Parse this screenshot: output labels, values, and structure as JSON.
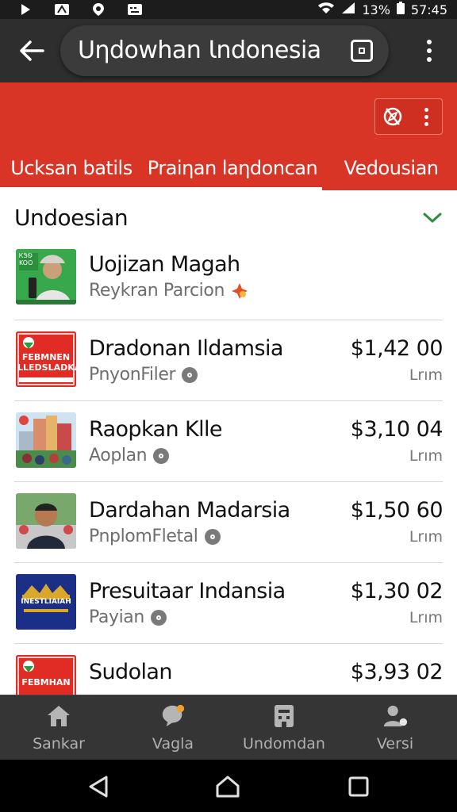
{
  "status_bar": {
    "battery_text": "13%",
    "time": "57:45",
    "icons": [
      "play-icon",
      "alert-icon",
      "location-icon",
      "keyboard-icon",
      "wifi-icon",
      "signal-icon",
      "battery-icon"
    ]
  },
  "app_bar": {
    "title": "Uηdowhan Ɩndonesia",
    "back_icon": "arrow-left-icon",
    "pill_icon": "square-icon",
    "more_icon": "more-vertical-icon"
  },
  "header": {
    "accent_color": "#d93526",
    "actions": [
      "compass-icon",
      "more-vertical-icon"
    ],
    "tabs": [
      {
        "label": "Ucksan batils",
        "active": true
      },
      {
        "label": "Praiηan laηdoncan",
        "active": true
      },
      {
        "label": "Vedousian",
        "active": false
      }
    ]
  },
  "section": {
    "title": "Undoesian",
    "chevron_icon": "chevron-down-icon",
    "chevron_color": "#2e8b3a"
  },
  "items": [
    {
      "title": "Uojizan Magah",
      "subtitle": "Reykran Parcion",
      "price": "",
      "unit": "",
      "thumb_icon": "profile-image"
    },
    {
      "title": "Dradonan Ildamsia",
      "subtitle": "PnyonFiler",
      "price": "$1,42 00",
      "unit": "Lrım",
      "thumb_icon": "red-logo-image"
    },
    {
      "title": "Raopkan Klle",
      "subtitle": "Aoplan",
      "price": "$3,10 04",
      "unit": "Lrım",
      "thumb_icon": "building-image"
    },
    {
      "title": "Dardahan Madarsia",
      "subtitle": "PnplomFletal",
      "price": "$1,50 60",
      "unit": "Lrım",
      "thumb_icon": "person-image"
    },
    {
      "title": "Presuitaar Indansia",
      "subtitle": "Payian",
      "price": "$1,30 02",
      "unit": "Lrım",
      "thumb_icon": "banner-image"
    },
    {
      "title": "Sudolan",
      "subtitle": "",
      "price": "$3,93 02",
      "unit": "",
      "thumb_icon": "red-logo-image"
    }
  ],
  "thumb_texts": {
    "t1_top": "ᏦᏕᏫ",
    "t1_mid": "KOO",
    "t2_top": "FEBMNEN",
    "t2_bot": "LLEDSLADKA",
    "t5": "INESTLIAIAH",
    "t6_top": "FEBMHAN"
  },
  "bottom_nav": [
    {
      "label": "Sankar",
      "icon": "home-icon"
    },
    {
      "label": "Vagla",
      "icon": "chat-bubble-icon"
    },
    {
      "label": "Undomdan",
      "icon": "building-icon"
    },
    {
      "label": "Versi",
      "icon": "person-icon"
    }
  ],
  "system_nav": [
    "back-triangle-icon",
    "home-outline-icon",
    "recents-square-icon"
  ]
}
